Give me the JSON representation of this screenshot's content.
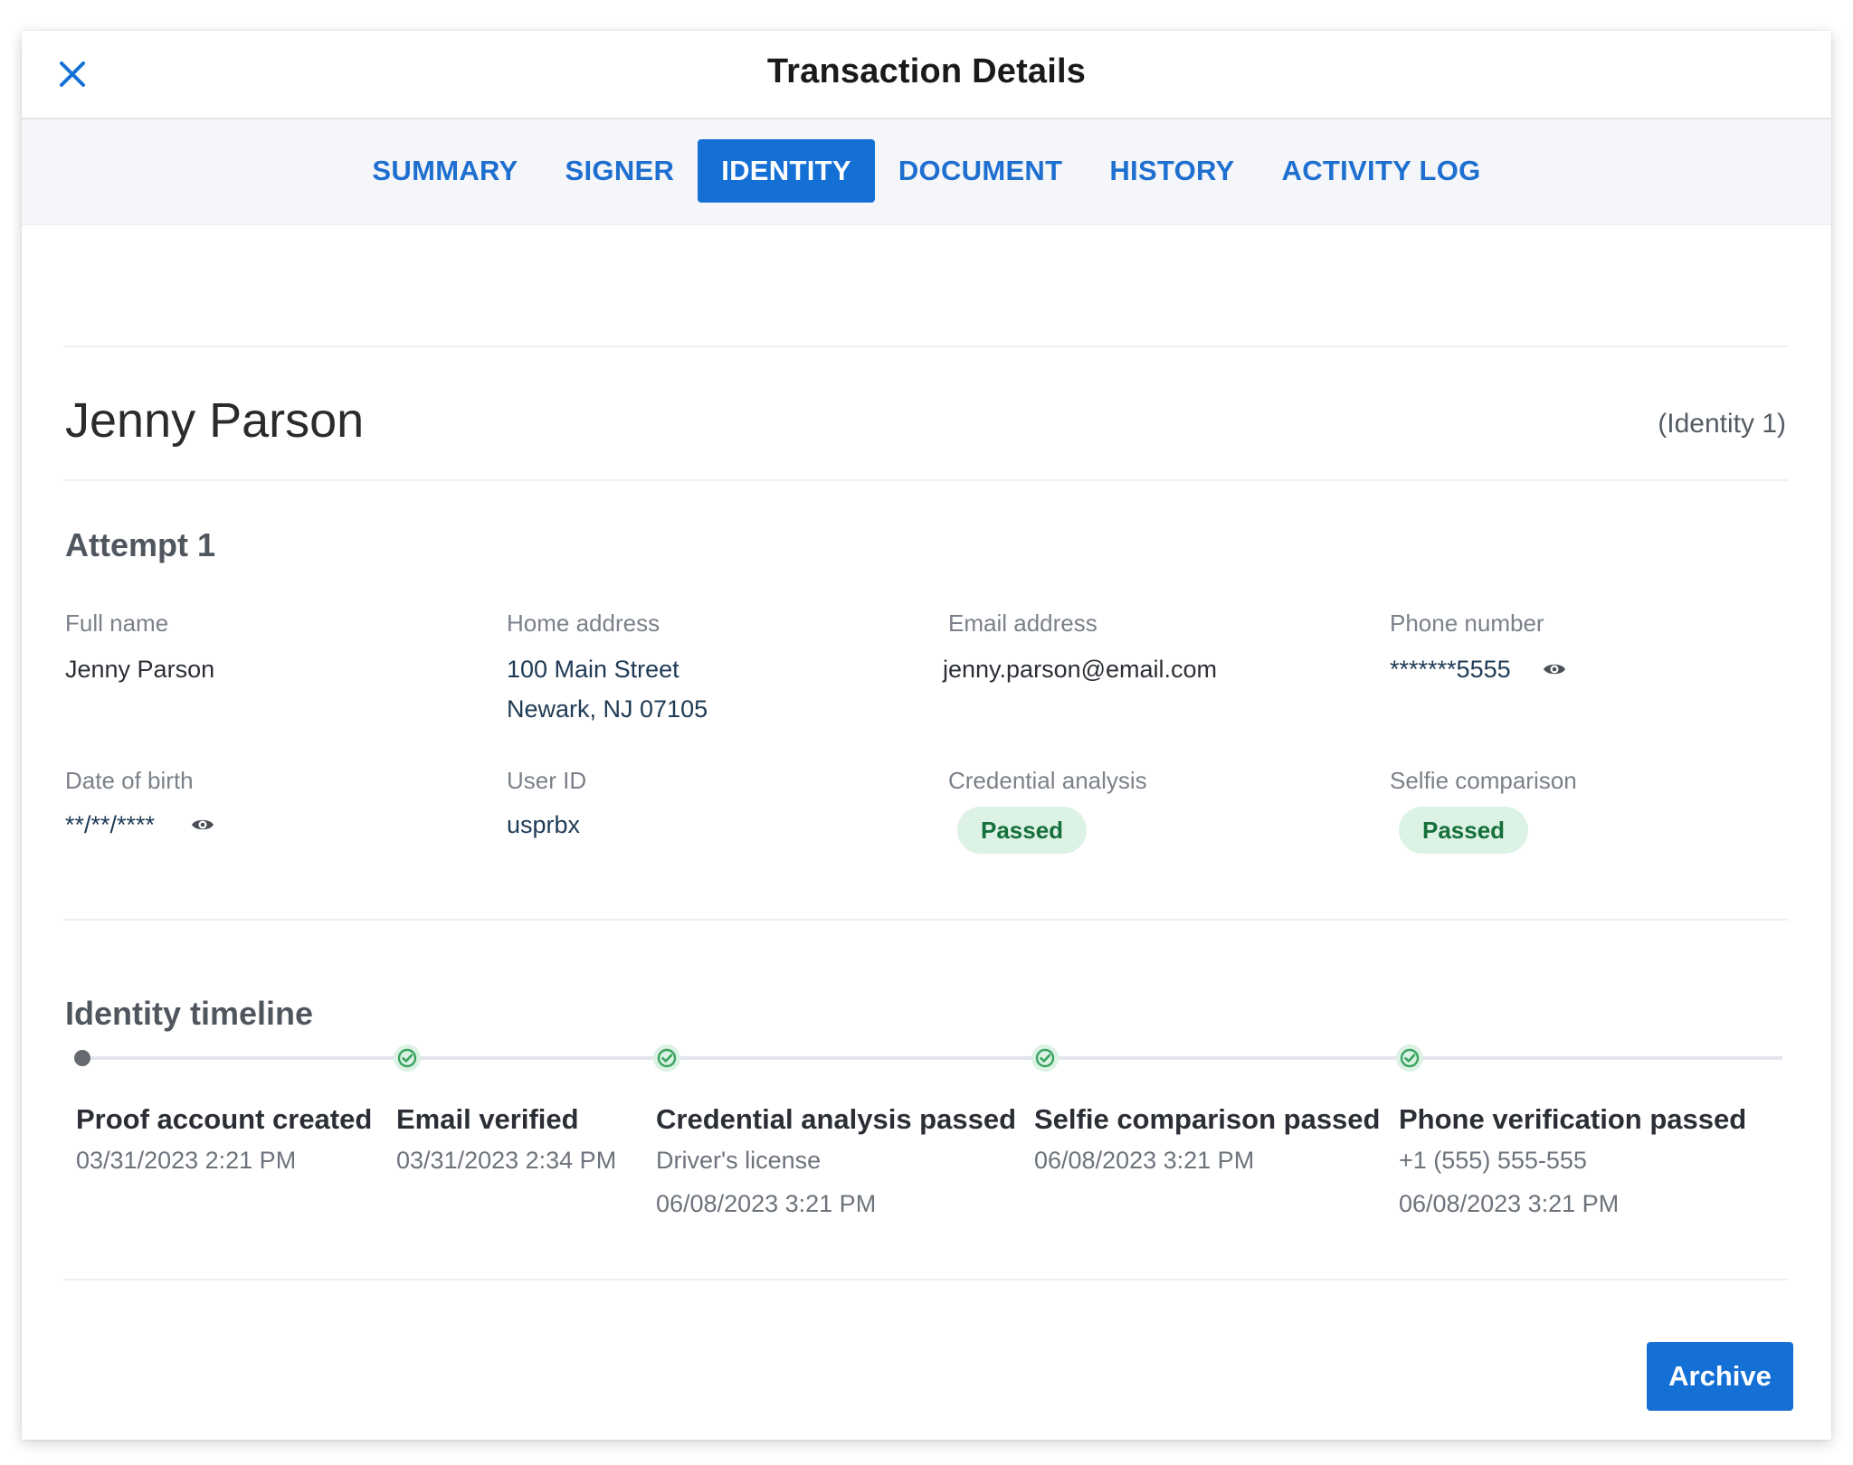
{
  "header": {
    "title": "Transaction Details"
  },
  "tabs": [
    {
      "label": "SUMMARY",
      "active": false
    },
    {
      "label": "SIGNER",
      "active": false
    },
    {
      "label": "IDENTITY",
      "active": true
    },
    {
      "label": "DOCUMENT",
      "active": false
    },
    {
      "label": "HISTORY",
      "active": false
    },
    {
      "label": "ACTIVITY LOG",
      "active": false
    }
  ],
  "identity": {
    "name": "Jenny Parson",
    "label": "(Identity 1)",
    "attempt_title": "Attempt 1",
    "fields": {
      "full_name": {
        "label": "Full name",
        "value": "Jenny Parson"
      },
      "home_address": {
        "label": "Home address",
        "line1": "100 Main Street",
        "line2": "Newark, NJ 07105"
      },
      "email": {
        "label": "Email address",
        "value": "jenny.parson@email.com"
      },
      "phone": {
        "label": "Phone number",
        "value": "*******5555"
      },
      "dob": {
        "label": "Date of birth",
        "value": "**/**/****"
      },
      "user_id": {
        "label": "User ID",
        "value": "usprbx"
      },
      "credential_analysis": {
        "label": "Credential analysis",
        "status": "Passed"
      },
      "selfie_comparison": {
        "label": "Selfie comparison",
        "status": "Passed"
      }
    }
  },
  "timeline": {
    "title": "Identity timeline",
    "events": [
      {
        "title": "Proof account created",
        "lines": [
          "03/31/2023 2:21 PM"
        ]
      },
      {
        "title": "Email verified",
        "lines": [
          "03/31/2023 2:34 PM"
        ]
      },
      {
        "title": "Credential analysis passed",
        "lines": [
          "Driver's license",
          "06/08/2023 3:21 PM"
        ]
      },
      {
        "title": "Selfie comparison passed",
        "lines": [
          "06/08/2023 3:21 PM"
        ]
      },
      {
        "title": "Phone verification passed",
        "lines": [
          "+1 (555) 555-555",
          "06/08/2023 3:21 PM"
        ]
      }
    ]
  },
  "footer": {
    "archive_label": "Archive"
  },
  "colors": {
    "accent": "#1570d6",
    "success_bg": "#dcf2e4",
    "success_text": "#16703b",
    "check": "#3aa35f"
  }
}
